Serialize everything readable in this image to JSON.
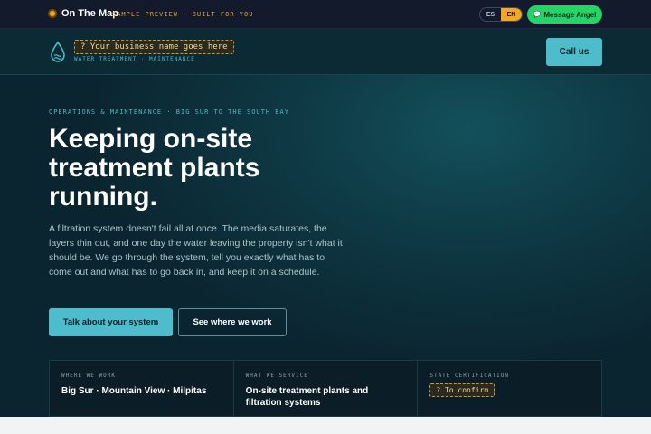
{
  "topbar": {
    "brand": "On The Map",
    "tagline": "SAMPLE PREVIEW · BUILT FOR YOU",
    "lang_es": "ES",
    "lang_en": "EN",
    "message_label": "Message Angel"
  },
  "business": {
    "name_placeholder": "? Your business name goes here",
    "subtitle": "WATER TREATMENT · MAINTENANCE",
    "call_label": "Call us"
  },
  "hero": {
    "eyebrow": "OPERATIONS & MAINTENANCE · BIG SUR TO THE SOUTH BAY",
    "headline": "Keeping on-site treatment plants running.",
    "lede": "A filtration system doesn't fail all at once. The media saturates, the layers thin out, and one day the water leaving the property isn't what it should be. We go through the system, tell you exactly what has to come out and what has to go back in, and keep it on a schedule.",
    "cta_primary": "Talk about your system",
    "cta_secondary": "See where we work"
  },
  "info": [
    {
      "label": "WHERE WE WORK",
      "value": "Big Sur · Mountain View · Milpitas"
    },
    {
      "label": "WHAT WE SERVICE",
      "value": "On-site treatment plants and filtration systems"
    },
    {
      "label": "STATE CERTIFICATION",
      "value": "? To confirm"
    }
  ],
  "colors": {
    "accent": "#4dbccb",
    "brand_orange": "#f5a623",
    "whatsapp_green": "#25d366"
  },
  "icons": {
    "brand": "brand-dot-icon",
    "message": "chat-bubble-icon",
    "logo": "water-drop-icon"
  }
}
